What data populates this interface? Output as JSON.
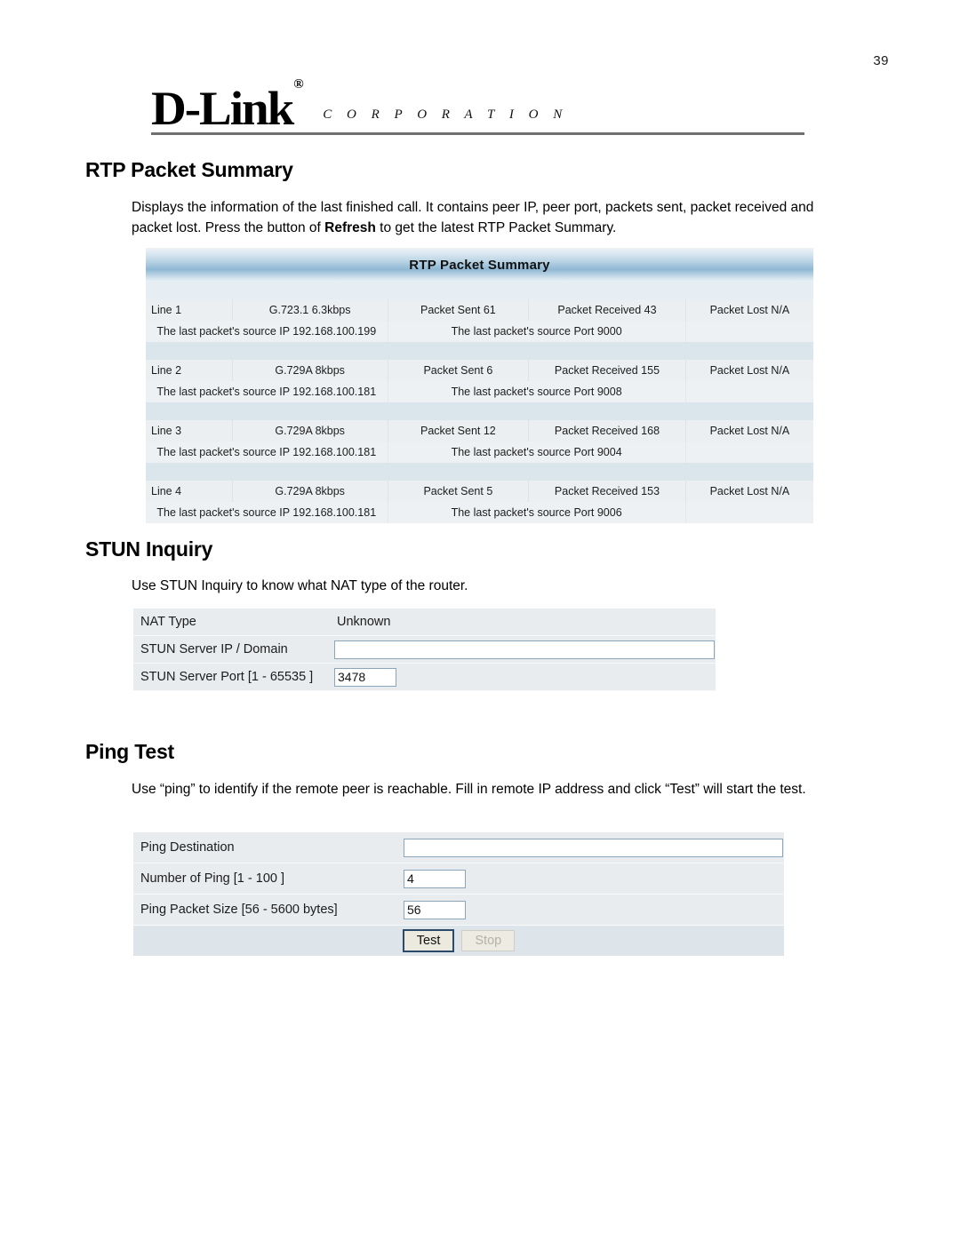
{
  "page": {
    "number": "39"
  },
  "header": {
    "logo_text": "D-Link",
    "logo_registered": "®",
    "logo_subtitle": "C O R P O R A T I O N"
  },
  "sections": {
    "rtp": {
      "title": "RTP Packet Summary",
      "description_part1": "Displays the information of the last finished call. It contains peer IP, peer port, packets sent, packet received and packet lost. Press the button of ",
      "description_bold": "Refresh",
      "description_part2": " to get the latest RTP Packet Summary.",
      "table_title": "RTP Packet Summary",
      "rows": [
        {
          "line": "Line 1",
          "codec": "G.723.1 6.3kbps",
          "sent": "Packet Sent 61",
          "received": "Packet Received 43",
          "lost": "Packet Lost N/A",
          "source_ip": "The last packet's source IP 192.168.100.199",
          "source_port": "The last packet's source Port 9000"
        },
        {
          "line": "Line 2",
          "codec": "G.729A 8kbps",
          "sent": "Packet Sent 6",
          "received": "Packet Received 155",
          "lost": "Packet Lost N/A",
          "source_ip": "The last packet's source IP 192.168.100.181",
          "source_port": "The last packet's source Port 9008"
        },
        {
          "line": "Line 3",
          "codec": "G.729A 8kbps",
          "sent": "Packet Sent 12",
          "received": "Packet Received 168",
          "lost": "Packet Lost N/A",
          "source_ip": "The last packet's source IP 192.168.100.181",
          "source_port": "The last packet's source Port 9004"
        },
        {
          "line": "Line 4",
          "codec": "G.729A 8kbps",
          "sent": "Packet Sent 5",
          "received": "Packet Received 153",
          "lost": "Packet Lost N/A",
          "source_ip": "The last packet's source IP 192.168.100.181",
          "source_port": "The last packet's source Port 9006"
        }
      ]
    },
    "stun": {
      "title": "STUN Inquiry",
      "description": "Use STUN Inquiry to know what NAT type of the router.",
      "fields": [
        {
          "label": "NAT Type",
          "value": "Unknown"
        },
        {
          "label": "STUN Server IP / Domain",
          "value": ""
        },
        {
          "label": "STUN Server Port [1 - 65535 ]",
          "value": "3478"
        }
      ]
    },
    "ping": {
      "title": "Ping Test",
      "description": "Use “ping” to identify if the remote peer is reachable. Fill in remote IP address and click “Test” will start the test.",
      "fields": [
        {
          "label": "Ping Destination",
          "value": ""
        },
        {
          "label": "Number of Ping [1 - 100 ]",
          "value": "4"
        },
        {
          "label": "Ping Packet Size [56 - 5600 bytes]",
          "value": "56"
        }
      ],
      "buttons": {
        "test": "Test",
        "stop": "Stop"
      }
    }
  },
  "colors": {
    "table_header_accent": "#8fb8d4",
    "form_row_bg": "#e8ecef",
    "input_border": "#8aa6bd",
    "focus_border": "#2b4a6b"
  }
}
